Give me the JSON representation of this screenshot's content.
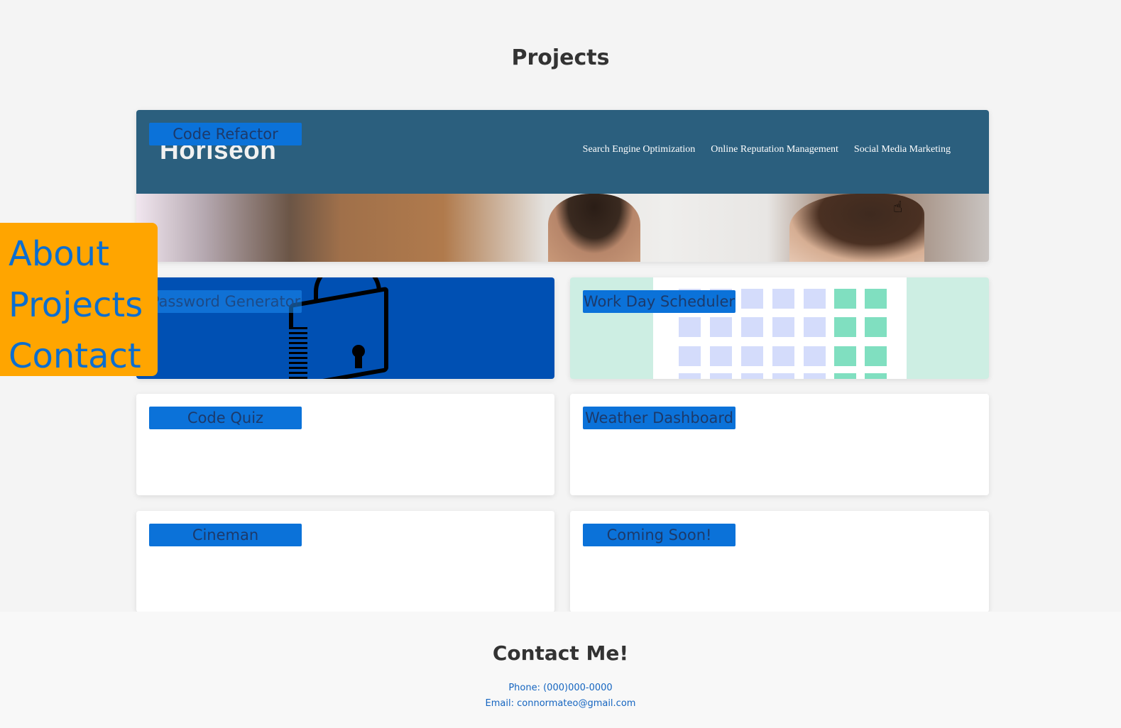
{
  "page": {
    "section_title": "Projects"
  },
  "sidenav": {
    "items": [
      {
        "label": "About"
      },
      {
        "label": "Projects"
      },
      {
        "label": "Contact"
      }
    ],
    "color_bg": "#ffa500",
    "color_link": "#0b6ed0"
  },
  "projects": {
    "code_refactor": {
      "label": "Code Refactor",
      "preview": {
        "logo": "Horiseon",
        "nav": [
          "Search Engine Optimization",
          "Online Reputation Management",
          "Social Media Marketing"
        ]
      }
    },
    "password_generator": {
      "label": "Password Generator"
    },
    "work_day_scheduler": {
      "label": "Work Day Scheduler"
    },
    "code_quiz": {
      "label": "Code Quiz"
    },
    "weather_dashboard": {
      "label": "Weather Dashboard"
    },
    "cineman": {
      "label": "Cineman"
    },
    "coming_soon": {
      "label": "Coming Soon!"
    }
  },
  "footer": {
    "title": "Contact Me!",
    "phone": "Phone: (000)000-0000",
    "email": "Email: connormateo@gmail.com"
  },
  "icons": {
    "cursor": "hand-pointer-icon",
    "lock": "padlock-icon"
  }
}
